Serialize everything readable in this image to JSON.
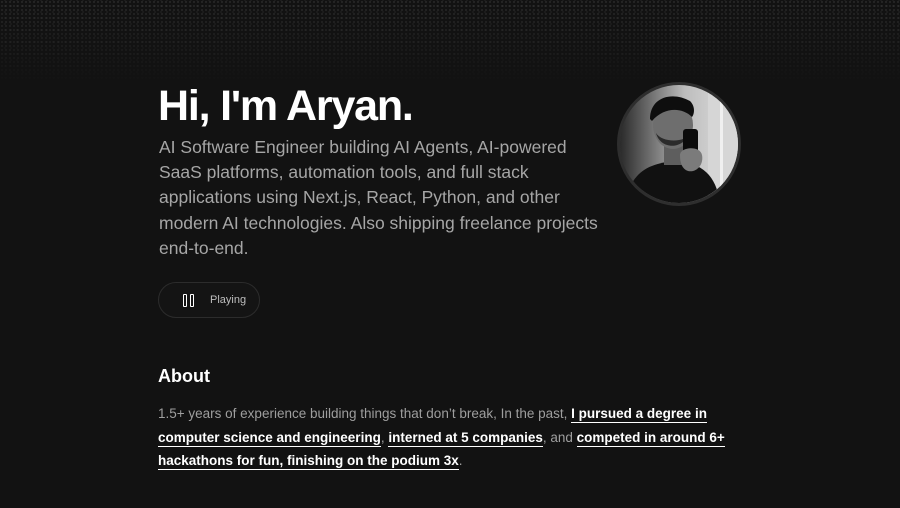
{
  "hero": {
    "title": "Hi, I'm Aryan.",
    "bio": "AI Software Engineer building AI Agents, AI-powered SaaS platforms, automation tools, and full stack applications using Next.js, React, Python, and other modern AI technologies. Also shipping freelance projects end-to-end.",
    "avatar_icon": "profile-photo"
  },
  "player": {
    "status_label": "Playing",
    "icon": "pause-icon"
  },
  "about": {
    "heading": "About",
    "text_1": "1.5+ years of experience building things that don’t break, In the past, ",
    "link_1": "I pursued a degree in computer science and engineering",
    "text_2": ", ",
    "link_2": "interned at 5 companies",
    "text_3": ", and ",
    "link_3": "competed in around 6+ hackathons for fun, finishing on the podium 3x",
    "text_4": "."
  },
  "colors": {
    "background": "#121212",
    "heading": "#ffffff",
    "body_text": "#a6a6a6",
    "link": "#ffffff"
  }
}
